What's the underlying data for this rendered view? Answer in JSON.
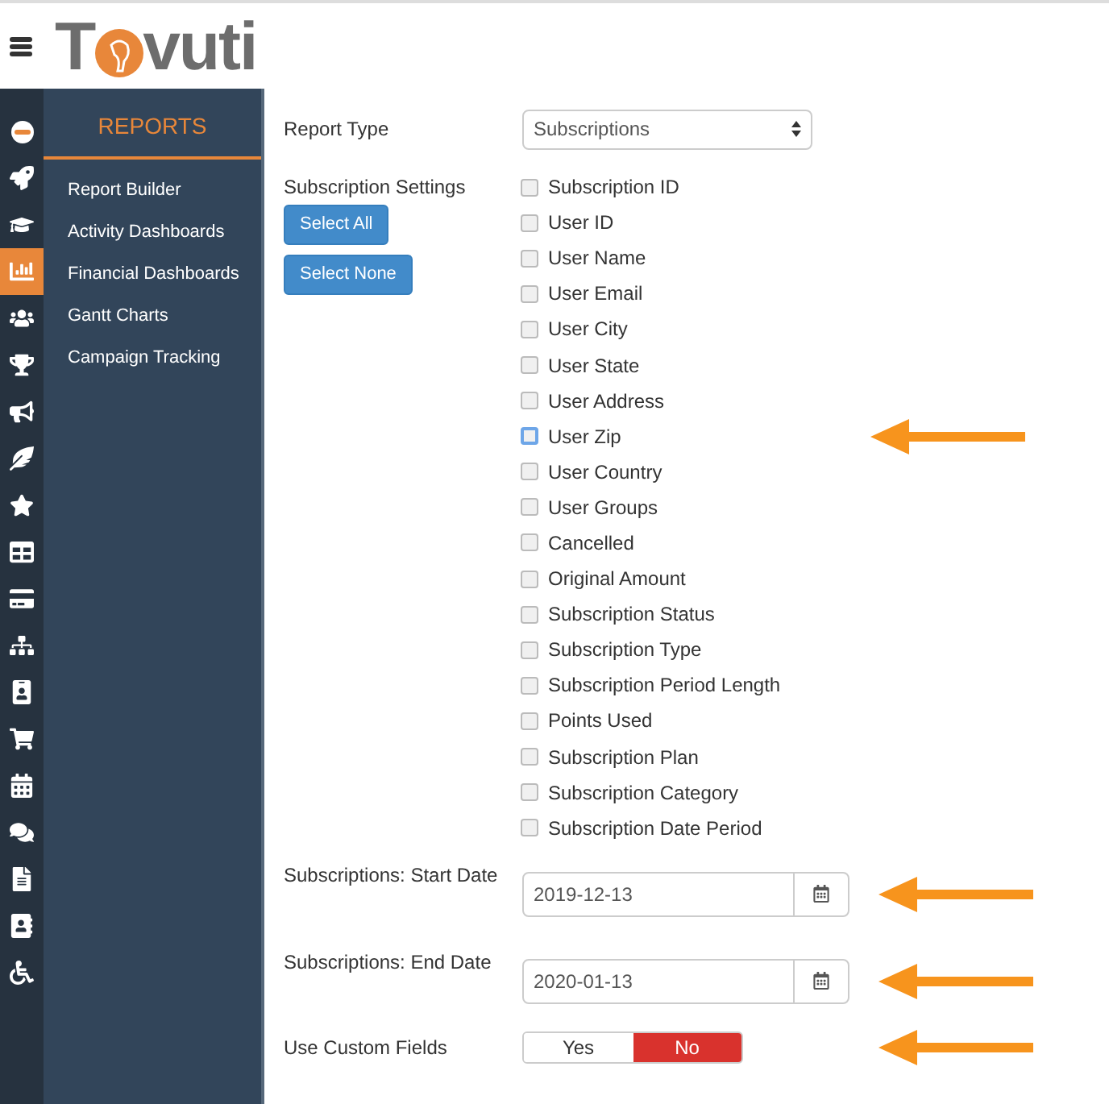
{
  "logo": {
    "parts": [
      "T",
      "vuti"
    ]
  },
  "rail": [
    {
      "selected": false
    },
    {
      "selected": false
    },
    {
      "selected": false
    },
    {
      "selected": true
    },
    {
      "selected": false
    },
    {
      "selected": false
    },
    {
      "selected": false
    },
    {
      "selected": false
    },
    {
      "selected": false
    },
    {
      "selected": false
    },
    {
      "selected": false
    },
    {
      "selected": false
    },
    {
      "selected": false
    },
    {
      "selected": false
    },
    {
      "selected": false
    },
    {
      "selected": false
    },
    {
      "selected": false
    },
    {
      "selected": false
    },
    {
      "selected": false
    }
  ],
  "menu": {
    "title": "REPORTS",
    "items": [
      "Report Builder",
      "Activity Dashboards",
      "Financial Dashboards",
      "Gantt Charts",
      "Campaign Tracking"
    ]
  },
  "report_type": {
    "label": "Report Type",
    "value": "Subscriptions"
  },
  "settings": {
    "label": "Subscription Settings",
    "buttons": [
      "Select All",
      "Select None"
    ],
    "fields": [
      {
        "label": "Subscription ID",
        "checked": false,
        "focused": false,
        "annotated": false
      },
      {
        "label": "User ID",
        "checked": false,
        "focused": false,
        "annotated": false
      },
      {
        "label": "User Name",
        "checked": false,
        "focused": false,
        "annotated": false
      },
      {
        "label": "User Email",
        "checked": false,
        "focused": false,
        "annotated": false
      },
      {
        "label": "User City",
        "checked": false,
        "focused": false,
        "annotated": false
      },
      {
        "label": "User State",
        "checked": false,
        "focused": false,
        "annotated": false
      },
      {
        "label": "User Address",
        "checked": false,
        "focused": false,
        "annotated": false
      },
      {
        "label": "User Zip",
        "checked": false,
        "focused": true,
        "annotated": true
      },
      {
        "label": "User Country",
        "checked": false,
        "focused": false,
        "annotated": false
      },
      {
        "label": "User Groups",
        "checked": false,
        "focused": false,
        "annotated": false
      },
      {
        "label": "Cancelled",
        "checked": false,
        "focused": false,
        "annotated": false
      },
      {
        "label": "Original Amount",
        "checked": false,
        "focused": false,
        "annotated": false
      },
      {
        "label": "Subscription Status",
        "checked": false,
        "focused": false,
        "annotated": false
      },
      {
        "label": "Subscription Type",
        "checked": false,
        "focused": false,
        "annotated": false
      },
      {
        "label": "Subscription Period Length",
        "checked": false,
        "focused": false,
        "annotated": false
      },
      {
        "label": "Points Used",
        "checked": false,
        "focused": false,
        "annotated": false
      },
      {
        "label": "Subscription Plan",
        "checked": false,
        "focused": false,
        "annotated": false
      },
      {
        "label": "Subscription Category",
        "checked": false,
        "focused": false,
        "annotated": false
      },
      {
        "label": "Subscription Date Period",
        "checked": false,
        "focused": false,
        "annotated": false
      }
    ]
  },
  "dates": [
    {
      "label": "Subscriptions: Start Date",
      "value": "2019-12-13",
      "annotated": true
    },
    {
      "label": "Subscriptions: End Date",
      "value": "2020-01-13",
      "annotated": true
    }
  ],
  "custom_fields": {
    "label": "Use Custom Fields",
    "annotated": true,
    "options": [
      {
        "label": "Yes",
        "selected": false
      },
      {
        "label": "No",
        "selected": true
      }
    ]
  }
}
